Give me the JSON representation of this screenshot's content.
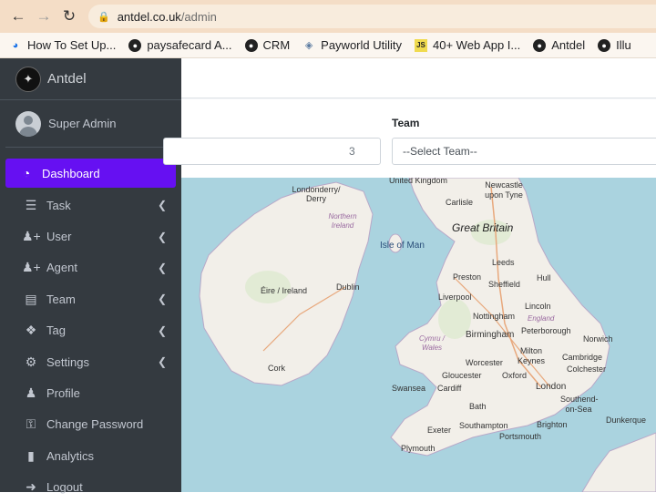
{
  "browser": {
    "url_host": "antdel.co.uk",
    "url_path": "/admin",
    "bookmarks": [
      {
        "label": "How To Set Up...",
        "icon": "hw-icon"
      },
      {
        "label": "paysafecard A...",
        "icon": "globe-icon"
      },
      {
        "label": "CRM",
        "icon": "globe-icon"
      },
      {
        "label": "Payworld Utility",
        "icon": "payworld-icon"
      },
      {
        "label": "40+ Web App I...",
        "icon": "js-icon"
      },
      {
        "label": "Antdel",
        "icon": "globe-icon"
      },
      {
        "label": "Illu",
        "icon": "globe-icon"
      }
    ]
  },
  "sidebar": {
    "brand": "Antdel",
    "user": "Super Admin",
    "active_color": "#6610f2",
    "items": [
      {
        "label": "Dashboard",
        "icon": "dashboard-icon",
        "active": true,
        "has_arrow": false
      },
      {
        "label": "Task",
        "icon": "list-icon",
        "has_arrow": true
      },
      {
        "label": "User",
        "icon": "user-plus-icon",
        "has_arrow": true
      },
      {
        "label": "Agent",
        "icon": "user-plus-icon",
        "has_arrow": true
      },
      {
        "label": "Team",
        "icon": "book-icon",
        "has_arrow": true
      },
      {
        "label": "Tag",
        "icon": "tags-icon",
        "has_arrow": true
      },
      {
        "label": "Settings",
        "icon": "gear-icon",
        "has_arrow": true
      },
      {
        "label": "Profile",
        "icon": "user-icon",
        "has_arrow": false
      },
      {
        "label": "Change Password",
        "icon": "lock-icon",
        "has_arrow": false
      },
      {
        "label": "Analytics",
        "icon": "chart-icon",
        "has_arrow": false
      },
      {
        "label": "Logout",
        "icon": "logout-icon",
        "has_arrow": false
      }
    ]
  },
  "filters": {
    "left_value": "3",
    "team_label": "Team",
    "team_select": "--Select Team--"
  },
  "map": {
    "labels": [
      "United Kingdom",
      "Newcastle upon Tyne",
      "Londonderry/ Derry",
      "Carlisle",
      "Northern Ireland",
      "Great Britain",
      "Isle of Man",
      "Leeds",
      "Preston",
      "Hull",
      "Éire / Ireland",
      "Dublin",
      "Liverpool",
      "Sheffield",
      "Lincoln",
      "Nottingham",
      "England",
      "Peterborough",
      "Norwich",
      "Cymru / Wales",
      "Birmingham",
      "Milton Keynes",
      "Cambridge",
      "Colchester",
      "Cork",
      "Worcester",
      "Oxford",
      "Gloucester",
      "London",
      "Swansea",
      "Cardiff",
      "Southend-on-Sea",
      "Bath",
      "Exeter",
      "Southampton",
      "Brighton",
      "Portsmouth",
      "Plymouth",
      "Dunkerque"
    ]
  }
}
